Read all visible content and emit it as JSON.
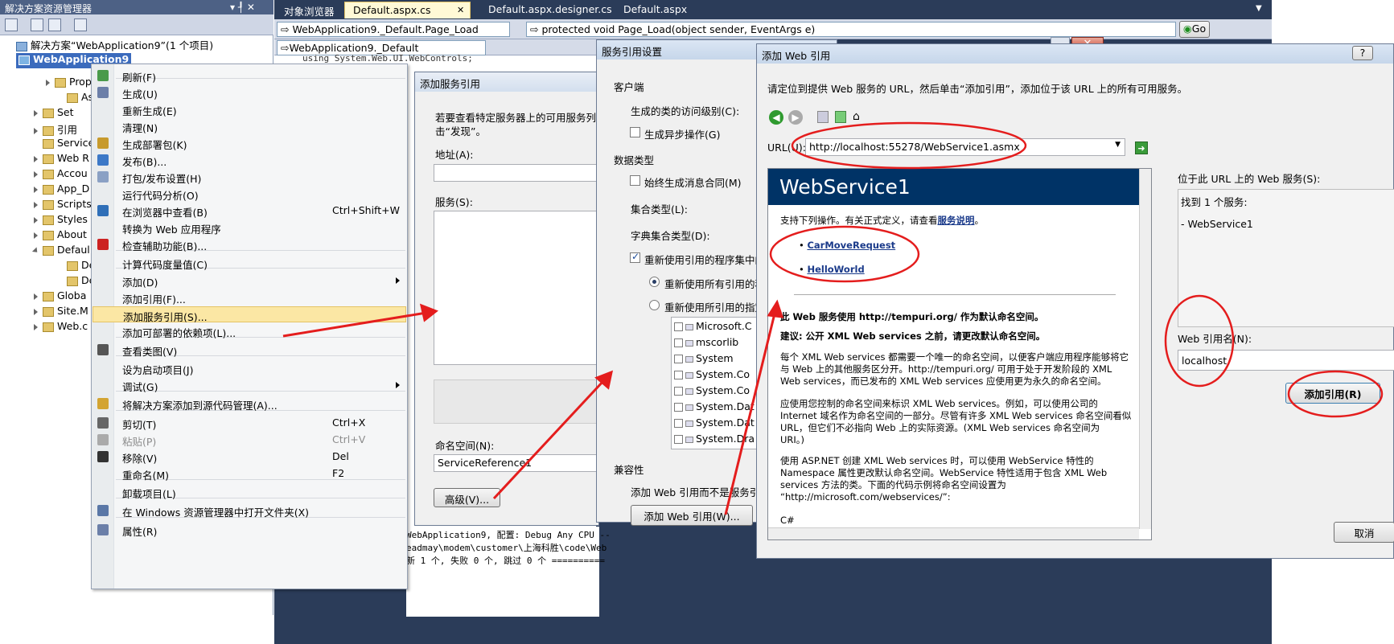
{
  "solution_explorer": {
    "title": "解决方案资源管理器",
    "title_controls": "▾ ┦ ✕",
    "solution_label": "解决方案“WebApplication9”(1 个项目)",
    "project": "WebApplication9",
    "items": [
      {
        "label": "Prope"
      },
      {
        "label": "Ass"
      },
      {
        "label": "Set"
      },
      {
        "label": "引用"
      },
      {
        "label": "Service"
      },
      {
        "label": "Web R"
      },
      {
        "label": "Accou"
      },
      {
        "label": "App_D"
      },
      {
        "label": "Scripts"
      },
      {
        "label": "Styles"
      },
      {
        "label": "About"
      },
      {
        "label": "Defaul"
      },
      {
        "label": "De"
      },
      {
        "label": "De"
      },
      {
        "label": "Globa"
      },
      {
        "label": "Site.M"
      },
      {
        "label": "Web.c"
      }
    ]
  },
  "editor": {
    "tabs": [
      "对象浏览器",
      "Default.aspx.cs",
      "Default.aspx.designer.cs",
      "Default.aspx"
    ],
    "tab_close": "✕",
    "class_combo": "WebApplication9._Default.Page_Load",
    "method_combo": "protected void Page_Load(object sender, EventArgs e)",
    "go_button": "Go",
    "type_combo": "WebApplication9._Default",
    "code_line": "using System.Web.UI.WebControls;",
    "output_lines": [
      "WebApplication9, 配置: Debug Any CPU --",
      "eadmay\\modem\\customer\\上海科胜\\code\\Web",
      "新 1 个, 失败 0 个, 跳过 0 个 =========="
    ]
  },
  "context_menu": {
    "items": [
      {
        "label": "刷新(F)",
        "shortcut": ""
      },
      {
        "label": "生成(U)",
        "shortcut": ""
      },
      {
        "label": "重新生成(E)",
        "shortcut": ""
      },
      {
        "label": "清理(N)",
        "shortcut": ""
      },
      {
        "label": "生成部署包(K)",
        "shortcut": ""
      },
      {
        "label": "发布(B)...",
        "shortcut": ""
      },
      {
        "label": "打包/发布设置(H)",
        "shortcut": ""
      },
      {
        "label": "运行代码分析(O)",
        "shortcut": ""
      },
      {
        "label": "在浏览器中查看(B)",
        "shortcut": "Ctrl+Shift+W"
      },
      {
        "label": "转换为 Web 应用程序",
        "shortcut": ""
      },
      {
        "label": "检查辅助功能(B)...",
        "shortcut": ""
      },
      {
        "label": "计算代码度量值(C)",
        "shortcut": ""
      },
      {
        "label": "添加(D)",
        "shortcut": ""
      },
      {
        "label": "添加引用(F)...",
        "shortcut": ""
      },
      {
        "label": "添加服务引用(S)...",
        "shortcut": ""
      },
      {
        "label": "添加可部署的依赖项(L)...",
        "shortcut": ""
      },
      {
        "label": "查看类图(V)",
        "shortcut": ""
      },
      {
        "label": "设为启动项目(J)",
        "shortcut": ""
      },
      {
        "label": "调试(G)",
        "shortcut": ""
      },
      {
        "label": "将解决方案添加到源代码管理(A)...",
        "shortcut": ""
      },
      {
        "label": "剪切(T)",
        "shortcut": "Ctrl+X"
      },
      {
        "label": "粘贴(P)",
        "shortcut": "Ctrl+V"
      },
      {
        "label": "移除(V)",
        "shortcut": "Del"
      },
      {
        "label": "重命名(M)",
        "shortcut": "F2"
      },
      {
        "label": "卸载项目(L)",
        "shortcut": ""
      },
      {
        "label": "在 Windows 资源管理器中打开文件夹(X)",
        "shortcut": ""
      },
      {
        "label": "属性(R)",
        "shortcut": ""
      }
    ]
  },
  "add_service_ref": {
    "title": "添加服务引用",
    "instructions": "若要查看特定服务器上的可用服务列表",
    "instructions2": "击“发现”。",
    "address_label": "地址(A):",
    "services_label": "服务(S):",
    "namespace_label": "命名空间(N):",
    "namespace_value": "ServiceReference1",
    "advanced_button": "高级(V)..."
  },
  "service_ref_settings": {
    "title": "服务引用设置",
    "client_group": "客户端",
    "access_level_label": "生成的类的访问级别(C):",
    "async_label": "生成异步操作(G)",
    "data_type_group": "数据类型",
    "message_contract_label": "始终生成消息合同(M)",
    "collection_type_label": "集合类型(L):",
    "dict_type_label": "字典集合类型(D):",
    "reuse_label": "重新使用引用的程序集中的",
    "reuse_all_label": "重新使用所有引用的程",
    "reuse_specified_label": "重新使用所引用的指定",
    "assemblies": [
      "Microsoft.C",
      "mscorlib",
      "System",
      "System.Co",
      "System.Co",
      "System.Dat",
      "System.Dat",
      "System.Dra"
    ],
    "compat_group": "兼容性",
    "compat_text": "添加 Web 引用而不是服务引",
    "add_web_ref_button": "添加 Web 引用(W)..."
  },
  "add_web_ref": {
    "title": "添加 Web 引用",
    "help": "?",
    "instructions": "请定位到提供 Web 服务的 URL，然后单击“添加引用”，添加位于该 URL 上的所有可用服务。",
    "url_label": "URL(U):",
    "url_value": "http://localhost:55278/WebService1.asmx",
    "services_at_url_label": "位于此 URL 上的 Web 服务(S):",
    "found_text": "找到 1 个服务:",
    "service_item": "- WebService1",
    "ref_name_label": "Web 引用名(N):",
    "ref_name_value": "localhost",
    "add_ref_button": "添加引用(R)",
    "cancel_button": "取消"
  },
  "webservice_page": {
    "title": "WebService1",
    "intro": "支持下列操作。有关正式定义，请查看",
    "intro_link": "服务说明",
    "intro_end": "。",
    "operations": [
      "CarMoveRequest",
      "HelloWorld"
    ],
    "namespace_notice": "此 Web 服务使用 http://tempuri.org/ 作为默认命名空间。",
    "recommendation": "建议: 公开 XML Web services 之前，请更改默认命名空间。",
    "para1": [
      "每个 XML Web services 都需要一个唯一的命名空间，以便客户端应用程序能够将它",
      "与 Web 上的其他服务区分开。http://tempuri.org/ 可用于处于开发阶段的 XML",
      "Web services，而已发布的 XML Web services 应使用更为永久的命名空间。"
    ],
    "para2": [
      "应使用您控制的命名空间来标识 XML Web services。例如，可以使用公司的",
      "Internet 域名作为命名空间的一部分。尽管有许多 XML Web services 命名空间看似",
      "URL，但它们不必指向 Web 上的实际资源。(XML Web services 命名空间为",
      "URI。)"
    ],
    "para3": [
      "使用 ASP.NET 创建 XML Web services 时，可以使用 WebService 特性的",
      "Namespace 属性更改默认命名空间。WebService 特性适用于包含 XML Web",
      "services 方法的类。下面的代码示例将命名空间设置为",
      "“http://microsoft.com/webservices/”:"
    ],
    "code_label": "C#"
  },
  "colors": {
    "accent_red": "#e41d1d",
    "vs_dark": "#2b3c59",
    "ws_header": "#003366"
  }
}
